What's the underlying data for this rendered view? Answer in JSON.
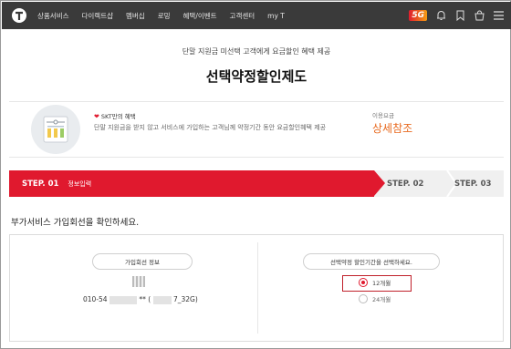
{
  "nav": {
    "items": [
      "상품서비스",
      "다이렉트샵",
      "멤버십",
      "로밍",
      "혜택/이벤트",
      "고객센터",
      "my T"
    ],
    "badge_5g": "5G",
    "icons": [
      "bell-icon",
      "bookmark-icon",
      "cart-icon",
      "menu-icon"
    ]
  },
  "header": {
    "subtitle": "단말 지원금 미선택 고객에게 요금할인 혜택 제공",
    "title": "선택약정할인제도"
  },
  "info": {
    "benefit_label": "SKT만의 혜택",
    "benefit_desc": "단말 지원금을 받지 않고 서비스에 가입하는 고객님께 약정기간 동안 요금할인혜택 제공",
    "fee_label": "이용요금",
    "fee_value": "상세참조"
  },
  "steps": {
    "step1": "STEP. 01",
    "step1_sub": "정보입력",
    "step2": "STEP. 02",
    "step3": "STEP. 03"
  },
  "question": "부가서비스 가입회선을 확인하세요.",
  "panel": {
    "left_pill": "가입회선 정보",
    "line_prefix": "010-54",
    "line_mid": "** (",
    "line_suffix": "7_32G)",
    "right_pill": "선택약정 할인기간을 선택하세요.",
    "options": [
      "12개월",
      "24개월"
    ],
    "selected": "12개월"
  },
  "colors": {
    "brand_red": "#e0192e",
    "fee_orange": "#e86a1f",
    "nav_bg": "#3a3a3a"
  }
}
